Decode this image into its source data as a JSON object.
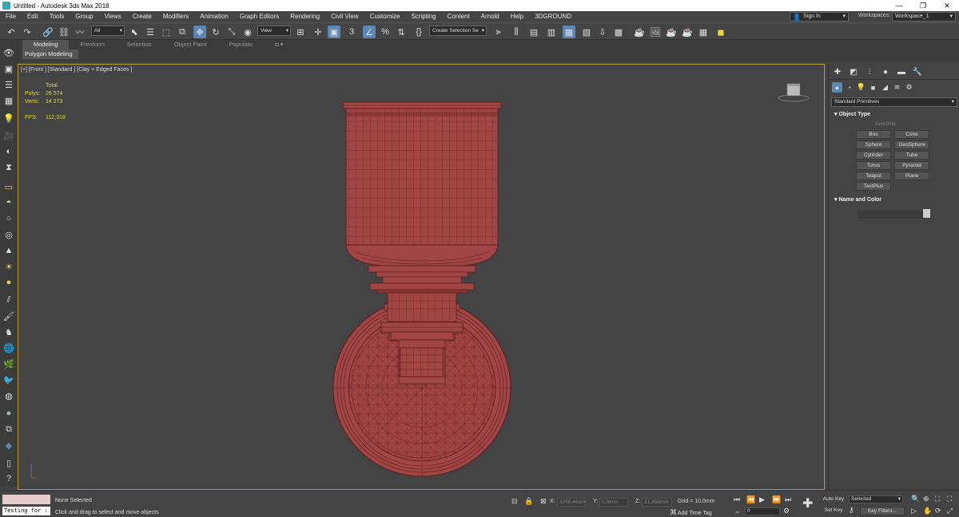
{
  "window": {
    "title": "Untitled - Autodesk 3ds Max 2018",
    "minimize": "—",
    "maximize": "❐",
    "close": "✕"
  },
  "menu": {
    "items": [
      "File",
      "Edit",
      "Tools",
      "Group",
      "Views",
      "Create",
      "Modifiers",
      "Animation",
      "Graph Editors",
      "Rendering",
      "Civil View",
      "Customize",
      "Scripting",
      "Content",
      "Arnold",
      "Help",
      "3DGROUND"
    ],
    "sign_in": "Sign In",
    "workspaces_label": "Workspaces:",
    "workspace_value": "Workspace_1"
  },
  "toolbar": {
    "selection_filter": "All",
    "ref_coord": "View",
    "named_selection": "Create Selection Se"
  },
  "ribbon": {
    "tabs": [
      "Modeling",
      "Freeform",
      "Selection",
      "Object Paint",
      "Populate"
    ],
    "active_tab": "Modeling",
    "sub_label": "Polygon Modeling"
  },
  "viewport": {
    "label": "[+] [Front ] [Standard ] [Clay + Edged Faces ]",
    "stats": {
      "total_label": "Total",
      "polys_label": "Polys:",
      "polys_value": "26 574",
      "verts_label": "Verts:",
      "verts_value": "14 273",
      "fps_label": "FPS:",
      "fps_value": "112,318"
    }
  },
  "command_panel": {
    "dropdown": "Standard Primitives",
    "object_type_title": "Object Type",
    "autogrid": "AutoGrid",
    "buttons": [
      "Box",
      "Cone",
      "Sphere",
      "GeoSphere",
      "Cylinder",
      "Tube",
      "Torus",
      "Pyramid",
      "Teapot",
      "Plane",
      "TextPlus"
    ],
    "name_color_title": "Name and Color"
  },
  "statusbar": {
    "listener_text": "Testing for :",
    "selection_status": "None Selected",
    "prompt": "Click and drag to select and move objects",
    "x_label": "X:",
    "x_value": "3256,468m",
    "y_label": "Y:",
    "y_value": "0,0mm",
    "z_label": "Z:",
    "z_value": "21,858mm",
    "grid": "Grid = 10,0mm",
    "add_time_tag": "Add Time Tag",
    "auto_key": "Auto Key",
    "set_key": "Set Key",
    "key_mode": "Selected",
    "key_filters": "Key Filters...",
    "frame": "0"
  },
  "colors": {
    "model": "#a24545",
    "model_dark": "#7a2e2e",
    "accent": "#5b87b5",
    "viewport_border": "#b99d3a"
  }
}
